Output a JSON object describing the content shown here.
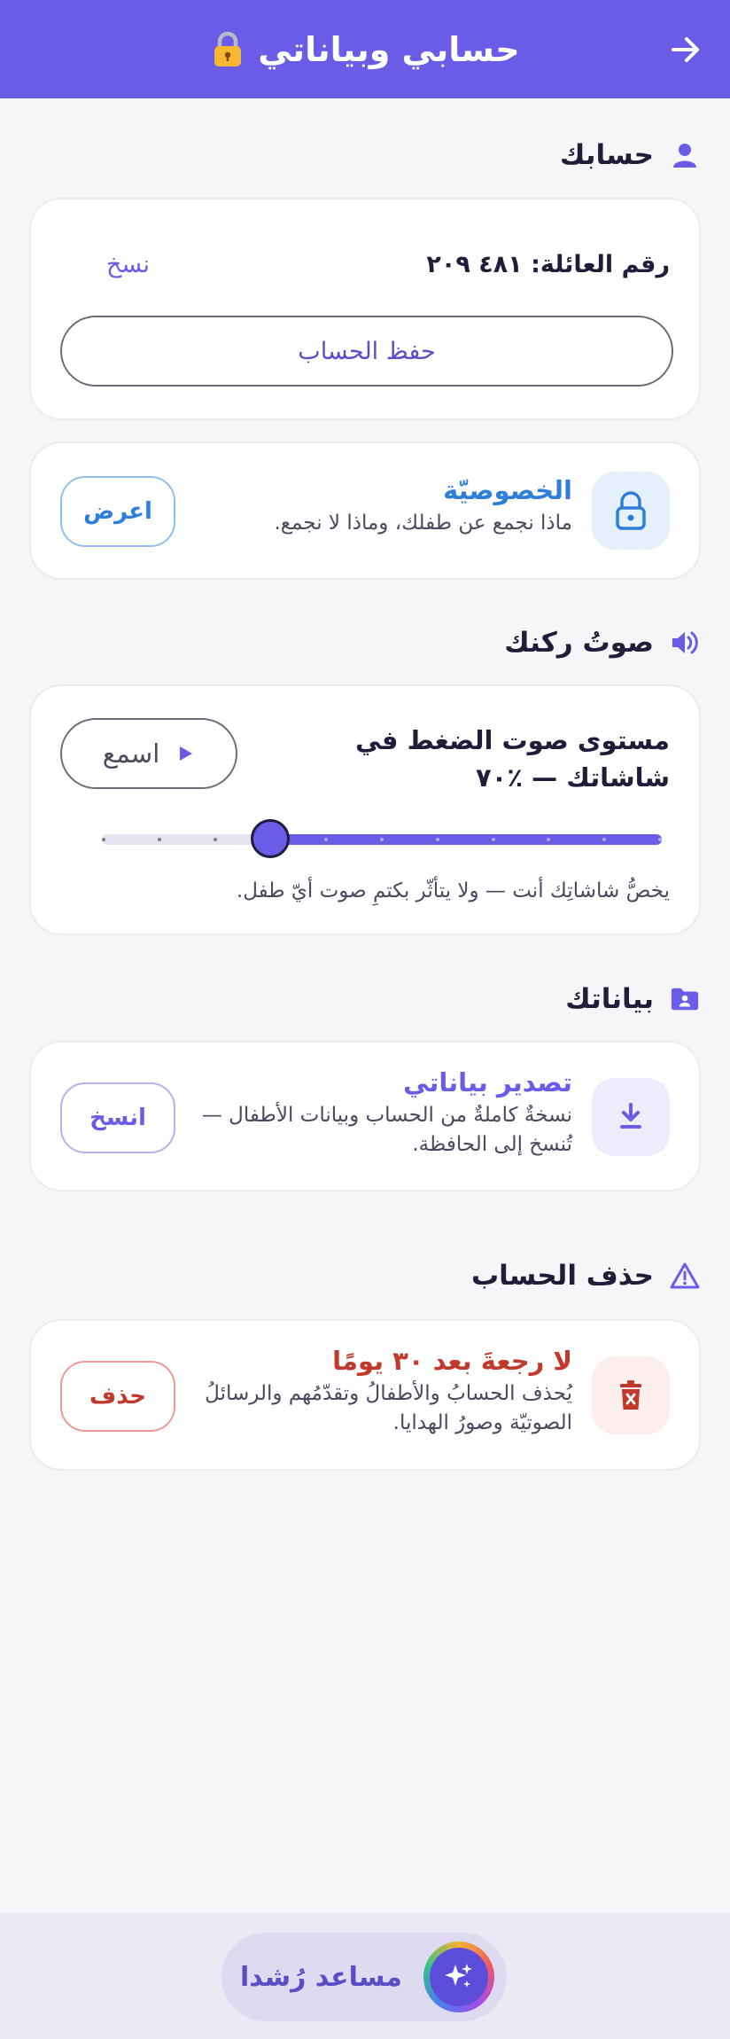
{
  "header": {
    "title": "حسابي وبياناتي",
    "title_icon": "lock-emoji-icon",
    "back_icon": "arrow-right-icon"
  },
  "account": {
    "section_title": "حسابك",
    "family_number": "رقم العائلة: ٤٨١ ٢٠٩",
    "copy_label": "نسخ",
    "save_account_label": "حفظ الحساب"
  },
  "privacy": {
    "title": "الخصوصيّة",
    "description": "ماذا نجمع عن طفلك، وماذا لا نجمع.",
    "button_label": "اعرض"
  },
  "voice": {
    "section_title": "صوتُ ركنك",
    "label": "مستوى صوت الضغط في شاشاتك — ٪٧٠",
    "listen_label": "اسمع",
    "level_percent": 70,
    "steps": 10,
    "note": "يخصُّ شاشاتِك أنت — ولا يتأثّر بكتمِ صوت أيّ طفل."
  },
  "data": {
    "section_title": "بياناتك",
    "export_title": "تصدير بياناتي",
    "export_description_line1": "نسخةٌ كاملةٌ من الحساب وبيانات الأطفال —",
    "export_description_line2": "تُنسخ إلى الحافظة.",
    "copy_button_label": "انسخ"
  },
  "delete": {
    "section_title": "حذف الحساب",
    "title": "لا رجعةَ بعد ٣٠ يومًا",
    "description_line1": "يُحذف الحسابُ والأطفالُ وتقدّمُهم والرسائلُ",
    "description_line2": "الصوتيّة وصورُ الهدايا.",
    "button_label": "حذف"
  },
  "assistant": {
    "label": "مساعد رُشدا"
  },
  "colors": {
    "brand": "#6b5ce7",
    "privacy_blue": "#2f7fd9",
    "danger_red": "#c0392b"
  }
}
